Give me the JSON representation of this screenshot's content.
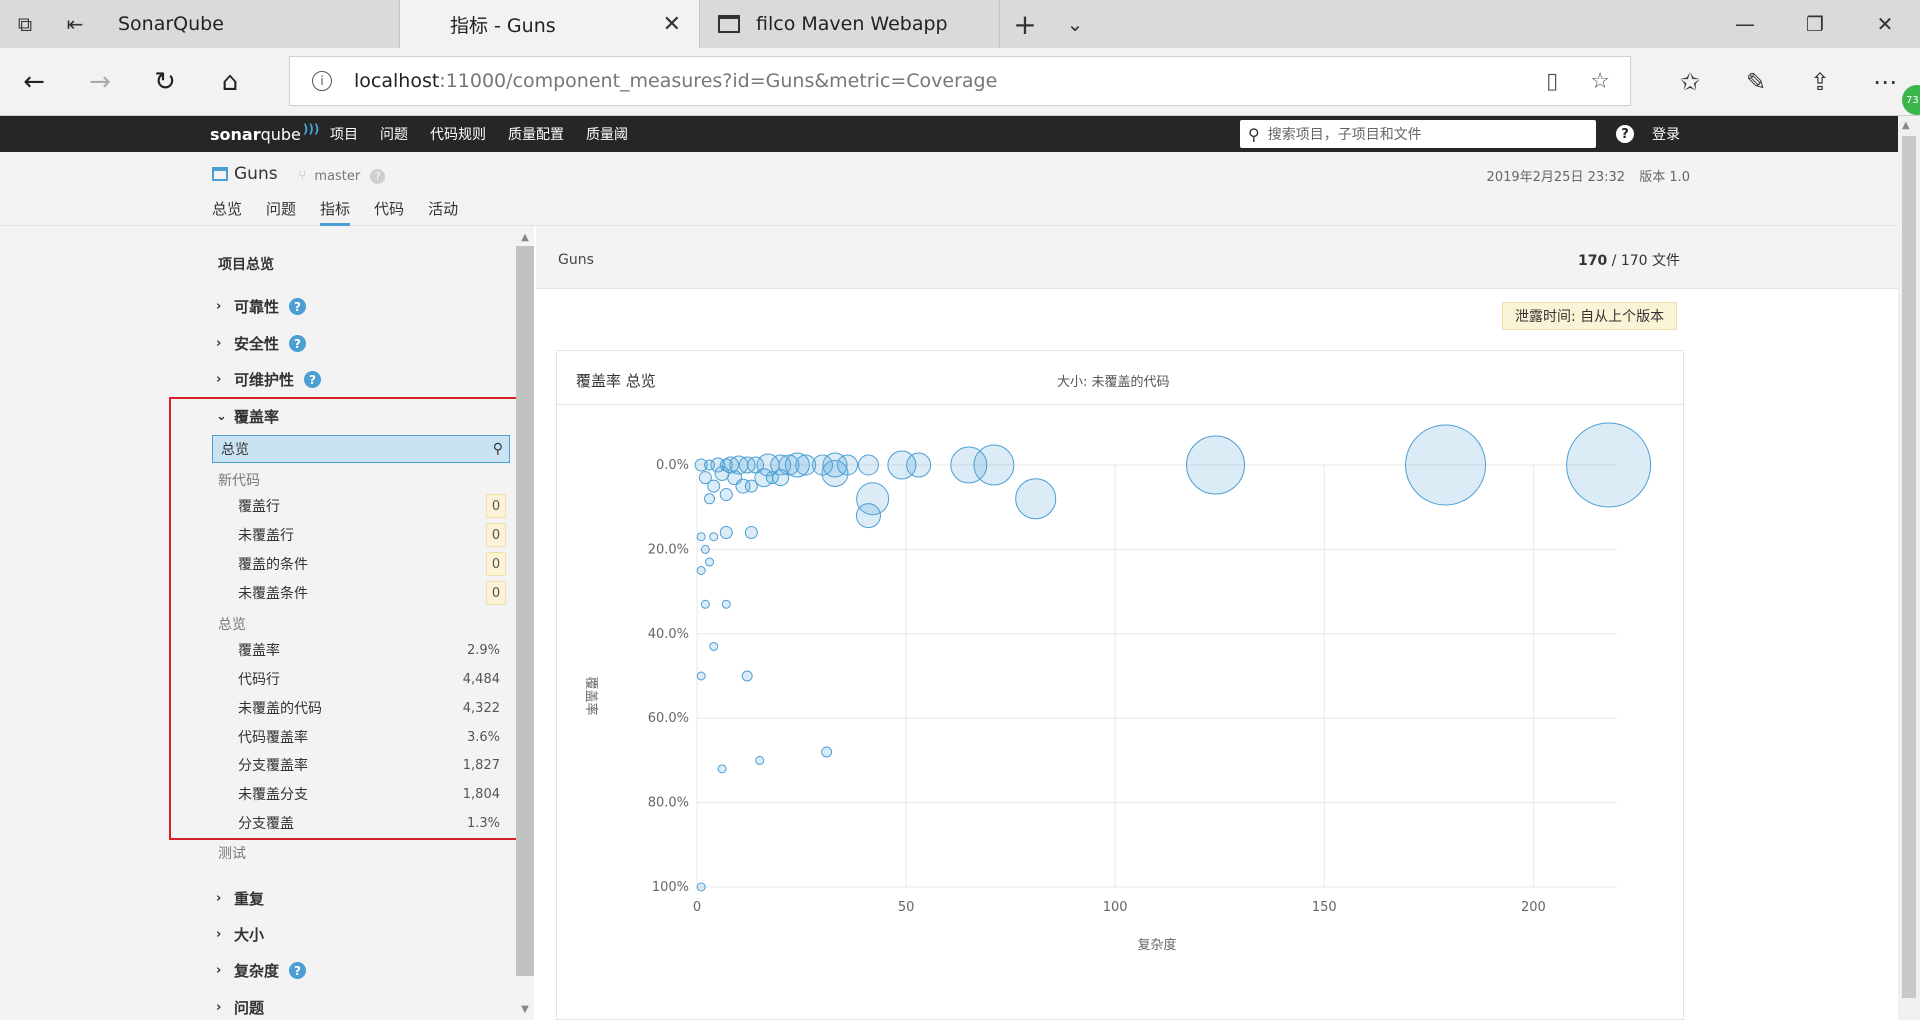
{
  "browser": {
    "tabs": [
      {
        "title": "SonarQube"
      },
      {
        "title": "指标 - Guns"
      },
      {
        "title": "filco Maven Webapp"
      }
    ],
    "address": {
      "host": "localhost",
      "rest": ":11000/component_measures?id=Guns&metric=Coverage"
    },
    "extension_badge": "73"
  },
  "sonar": {
    "logo_bold": "sonar",
    "logo_thin": "qube",
    "menu": [
      "项目",
      "问题",
      "代码规则",
      "质量配置",
      "质量阈"
    ],
    "search_placeholder": "搜索项目，子项目和文件",
    "help": "?",
    "login": "登录"
  },
  "project": {
    "name": "Guns",
    "branch": "master",
    "date": "2019年2月25日 23:32",
    "version": "版本 1.0",
    "tabs": [
      "总览",
      "问题",
      "指标",
      "代码",
      "活动"
    ]
  },
  "sidebar": {
    "title": "项目总览",
    "groups_top": [
      "可靠性",
      "安全性",
      "可维护性"
    ],
    "coverage_group": "覆盖率",
    "selected": "总览",
    "new_code_label": "新代码",
    "new_code_items": [
      {
        "label": "覆盖行",
        "value": "0"
      },
      {
        "label": "未覆盖行",
        "value": "0"
      },
      {
        "label": "覆盖的条件",
        "value": "0"
      },
      {
        "label": "未覆盖条件",
        "value": "0"
      }
    ],
    "overall_label": "总览",
    "overall_items": [
      {
        "label": "覆盖率",
        "value": "2.9%"
      },
      {
        "label": "代码行",
        "value": "4,484"
      },
      {
        "label": "未覆盖的代码",
        "value": "4,322"
      },
      {
        "label": "代码覆盖率",
        "value": "3.6%"
      },
      {
        "label": "分支覆盖率",
        "value": "1,827"
      },
      {
        "label": "未覆盖分支",
        "value": "1,804"
      },
      {
        "label": "分支覆盖",
        "value": "1.3%"
      }
    ],
    "tests_label": "测试",
    "groups_bottom": [
      "重复",
      "大小",
      "复杂度",
      "问题"
    ]
  },
  "main": {
    "breadcrumb": "Guns",
    "file_count_bold": "170",
    "file_count_rest": " / 170 文件",
    "leak_period": "泄露时间: 自从上个版本",
    "chart_title": "覆盖率 总览",
    "chart_size_label": "大小: 未覆盖的代码"
  },
  "chart_data": {
    "type": "scatter",
    "title": "覆盖率 总览",
    "xlabel": "复杂度",
    "ylabel": "覆盖率",
    "xlim": [
      0,
      220
    ],
    "ylim": [
      0,
      100
    ],
    "y_inverted": true,
    "x_ticks": [
      "0",
      "50",
      "100",
      "150",
      "200"
    ],
    "y_ticks": [
      "0.0%",
      "20.0%",
      "40.0%",
      "60.0%",
      "80.0%",
      "100%"
    ],
    "bubble_color": "#4b9fd5",
    "points": [
      {
        "x": 218,
        "y": 0,
        "r": 42
      },
      {
        "x": 179,
        "y": 0,
        "r": 40
      },
      {
        "x": 124,
        "y": 0,
        "r": 29
      },
      {
        "x": 81,
        "y": 8,
        "r": 20
      },
      {
        "x": 71,
        "y": 0,
        "r": 20
      },
      {
        "x": 65,
        "y": 0,
        "r": 18
      },
      {
        "x": 53,
        "y": 0,
        "r": 12
      },
      {
        "x": 49,
        "y": 0,
        "r": 14
      },
      {
        "x": 42,
        "y": 8,
        "r": 16
      },
      {
        "x": 41,
        "y": 12,
        "r": 12
      },
      {
        "x": 41,
        "y": 0,
        "r": 10
      },
      {
        "x": 36,
        "y": 0,
        "r": 10
      },
      {
        "x": 33,
        "y": 0,
        "r": 12
      },
      {
        "x": 33,
        "y": 2,
        "r": 13
      },
      {
        "x": 30,
        "y": 0,
        "r": 10
      },
      {
        "x": 26,
        "y": 0,
        "r": 10
      },
      {
        "x": 24,
        "y": 0,
        "r": 12
      },
      {
        "x": 22,
        "y": 0,
        "r": 10
      },
      {
        "x": 20,
        "y": 0,
        "r": 10
      },
      {
        "x": 17,
        "y": 0,
        "r": 11
      },
      {
        "x": 20,
        "y": 3,
        "r": 8
      },
      {
        "x": 16,
        "y": 3,
        "r": 9
      },
      {
        "x": 14,
        "y": 0,
        "r": 8
      },
      {
        "x": 12,
        "y": 0,
        "r": 8
      },
      {
        "x": 11,
        "y": 5,
        "r": 7
      },
      {
        "x": 10,
        "y": 0,
        "r": 9
      },
      {
        "x": 9,
        "y": 3,
        "r": 7
      },
      {
        "x": 8,
        "y": 0,
        "r": 8
      },
      {
        "x": 7,
        "y": 7,
        "r": 6
      },
      {
        "x": 6,
        "y": 2,
        "r": 7
      },
      {
        "x": 5,
        "y": 0,
        "r": 7
      },
      {
        "x": 4,
        "y": 5,
        "r": 6
      },
      {
        "x": 3,
        "y": 8,
        "r": 5
      },
      {
        "x": 2,
        "y": 3,
        "r": 6
      },
      {
        "x": 1,
        "y": 0,
        "r": 6
      },
      {
        "x": 3,
        "y": 0,
        "r": 5
      },
      {
        "x": 7,
        "y": 0,
        "r": 6
      },
      {
        "x": 13,
        "y": 5,
        "r": 6
      },
      {
        "x": 18,
        "y": 3,
        "r": 6
      },
      {
        "x": 13,
        "y": 16,
        "r": 6
      },
      {
        "x": 7,
        "y": 16,
        "r": 6
      },
      {
        "x": 4,
        "y": 17,
        "r": 4
      },
      {
        "x": 1,
        "y": 17,
        "r": 4
      },
      {
        "x": 2,
        "y": 20,
        "r": 4
      },
      {
        "x": 3,
        "y": 23,
        "r": 4
      },
      {
        "x": 1,
        "y": 25,
        "r": 4
      },
      {
        "x": 7,
        "y": 33,
        "r": 4
      },
      {
        "x": 2,
        "y": 33,
        "r": 4
      },
      {
        "x": 4,
        "y": 43,
        "r": 4
      },
      {
        "x": 1,
        "y": 50,
        "r": 4
      },
      {
        "x": 12,
        "y": 50,
        "r": 5
      },
      {
        "x": 31,
        "y": 68,
        "r": 5
      },
      {
        "x": 15,
        "y": 70,
        "r": 4
      },
      {
        "x": 6,
        "y": 72,
        "r": 4
      },
      {
        "x": 1,
        "y": 100,
        "r": 4
      }
    ]
  }
}
